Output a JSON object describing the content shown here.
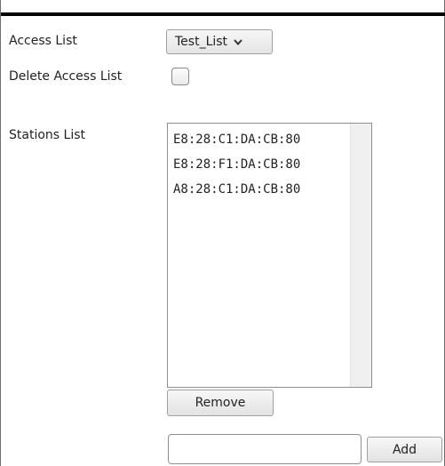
{
  "form": {
    "access_list_label": "Access List",
    "access_list_selected": "Test_List",
    "delete_access_list_label": "Delete Access List",
    "delete_checked": false,
    "stations_list_label": "Stations List",
    "stations": [
      "E8:28:C1:DA:CB:80",
      "E8:28:F1:DA:CB:80",
      "A8:28:C1:DA:CB:80"
    ],
    "remove_button": "Remove",
    "new_station_value": "",
    "add_button": "Add"
  }
}
